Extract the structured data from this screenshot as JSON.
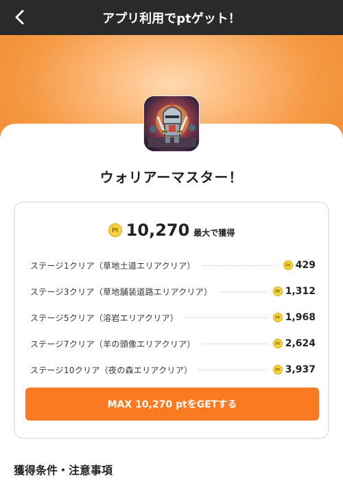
{
  "header": {
    "title": "アプリ利用でptゲット！",
    "back_icon": "chevron-left-icon"
  },
  "app": {
    "name": "ウォリアーマスター！",
    "icon": "knight-warrior-icon"
  },
  "reward": {
    "coin_label": "Pt",
    "total_points": "10,270",
    "total_suffix": "最大で獲得",
    "stages": [
      {
        "label": "ステージ1クリア（草地土道エリアクリア）",
        "points": "429"
      },
      {
        "label": "ステージ3クリア（草地舗装道路エリアクリア）",
        "points": "1,312"
      },
      {
        "label": "ステージ5クリア（溶岩エリアクリア）",
        "points": "1,968"
      },
      {
        "label": "ステージ7クリア（羊の頭像エリアクリア）",
        "points": "2,624"
      },
      {
        "label": "ステージ10クリア（夜の森エリアクリア）",
        "points": "3,937"
      }
    ],
    "cta_label": "MAX 10,270 ptをGETする"
  },
  "conditions": {
    "title": "獲得条件・注意事項"
  },
  "colors": {
    "header_bg": "#2a2a2a",
    "hero_orange": "#f59a45",
    "cta_orange": "#fa7a22",
    "coin_gold": "#f4d33c"
  }
}
